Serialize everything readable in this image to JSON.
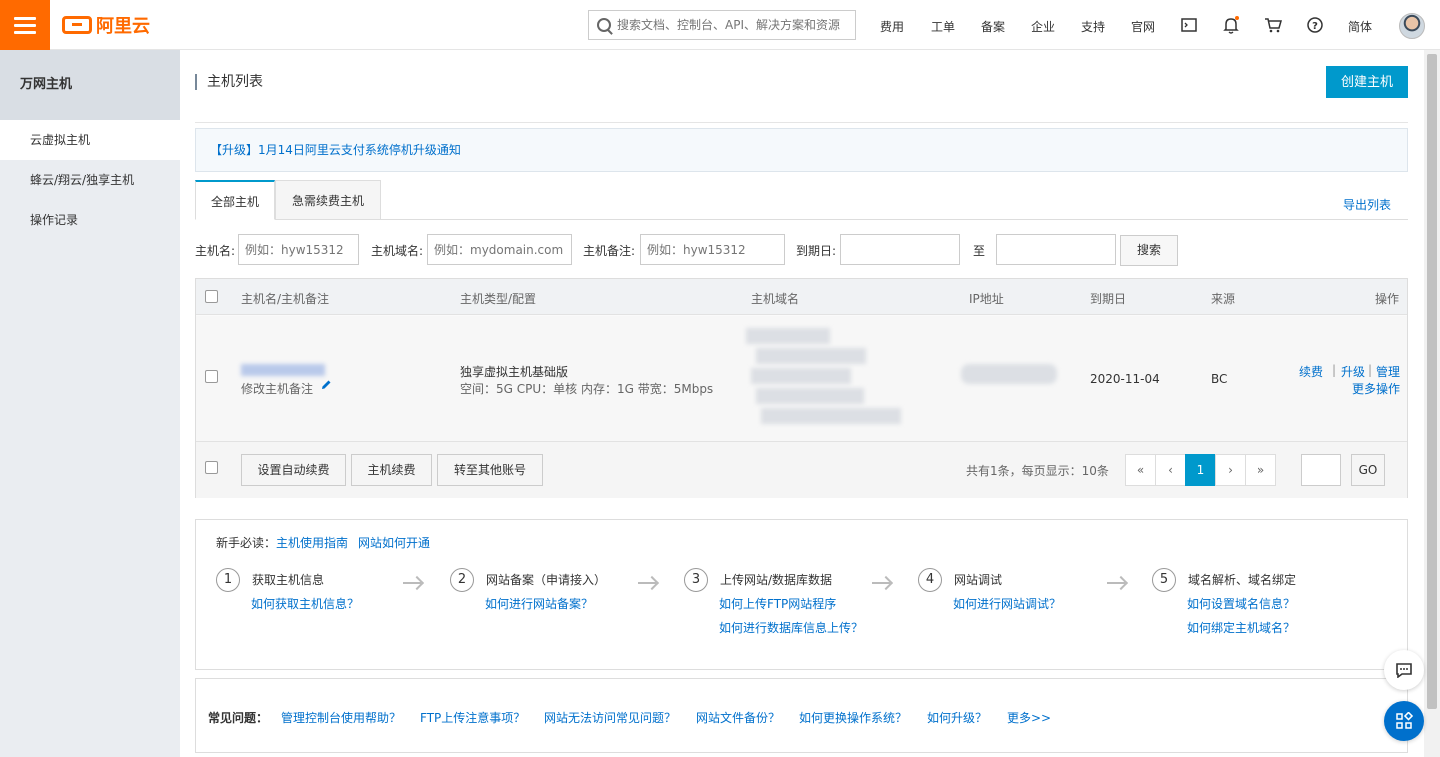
{
  "header": {
    "logo_text": "阿里云",
    "search_placeholder": "搜索文档、控制台、API、解决方案和资源",
    "nav": [
      "费用",
      "工单",
      "备案",
      "企业",
      "支持",
      "官网"
    ],
    "lang": "简体",
    "notification_dot_color": "#ff6a00"
  },
  "sidebar": {
    "title": "万网主机",
    "items": [
      {
        "label": "云虚拟主机",
        "active": true
      },
      {
        "label": "蜂云/翔云/独享主机",
        "active": false
      },
      {
        "label": "操作记录",
        "active": false
      }
    ]
  },
  "main": {
    "title": "主机列表",
    "create_button": "创建主机",
    "notice": "【升级】1月14日阿里云支付系统停机升级通知",
    "tabs": [
      {
        "label": "全部主机",
        "active": true
      },
      {
        "label": "急需续费主机",
        "active": false
      }
    ],
    "export_link": "导出列表",
    "filters": {
      "host_name_label": "主机名:",
      "host_name_placeholder": "例如：hyw15312",
      "domain_label": "主机域名:",
      "domain_placeholder": "例如：mydomain.com",
      "remark_label": "主机备注:",
      "remark_placeholder": "例如：hyw15312",
      "expire_label": "到期日:",
      "to_label": "至",
      "search_button": "搜索"
    },
    "table": {
      "columns": [
        "主机名/主机备注",
        "主机类型/配置",
        "主机域名",
        "IP地址",
        "到期日",
        "来源",
        "操作"
      ],
      "rows": [
        {
          "remark_action": "修改主机备注",
          "type": "独享虚拟主机基础版",
          "config": "空间：5G CPU：单核 内存：1G 带宽：5Mbps",
          "expire": "2020-11-04",
          "source": "BC",
          "actions": [
            "续费",
            "升级",
            "管理"
          ],
          "more_actions": "更多操作"
        }
      ],
      "bulk_buttons": [
        "设置自动续费",
        "主机续费",
        "转至其他账号"
      ],
      "summary": "共有1条，每页显示：10条",
      "pager": {
        "first": "«",
        "prev": "‹",
        "current": "1",
        "next": "›",
        "last": "»"
      },
      "go_button": "GO"
    },
    "guide": {
      "prefix": "新手必读：",
      "links": [
        "主机使用指南",
        "网站如何开通"
      ],
      "steps": [
        {
          "num": "1",
          "title": "获取主机信息",
          "links": [
            "如何获取主机信息？"
          ]
        },
        {
          "num": "2",
          "title": "网站备案（申请接入）",
          "links": [
            "如何进行网站备案？"
          ]
        },
        {
          "num": "3",
          "title": "上传网站/数据库数据",
          "links": [
            "如何上传FTP网站程序",
            "如何进行数据库信息上传？"
          ]
        },
        {
          "num": "4",
          "title": "网站调试",
          "links": [
            "如何进行网站调试？"
          ]
        },
        {
          "num": "5",
          "title": "域名解析、域名绑定",
          "links": [
            "如何设置域名信息？",
            "如何绑定主机域名？"
          ]
        }
      ]
    },
    "faq": {
      "title": "常见问题：",
      "links": [
        "管理控制台使用帮助？",
        "FTP上传注意事项？",
        "网站无法访问常见问题？",
        "网站文件备份？",
        "如何更换操作系统？",
        "如何升级？",
        "更多>>"
      ]
    }
  }
}
